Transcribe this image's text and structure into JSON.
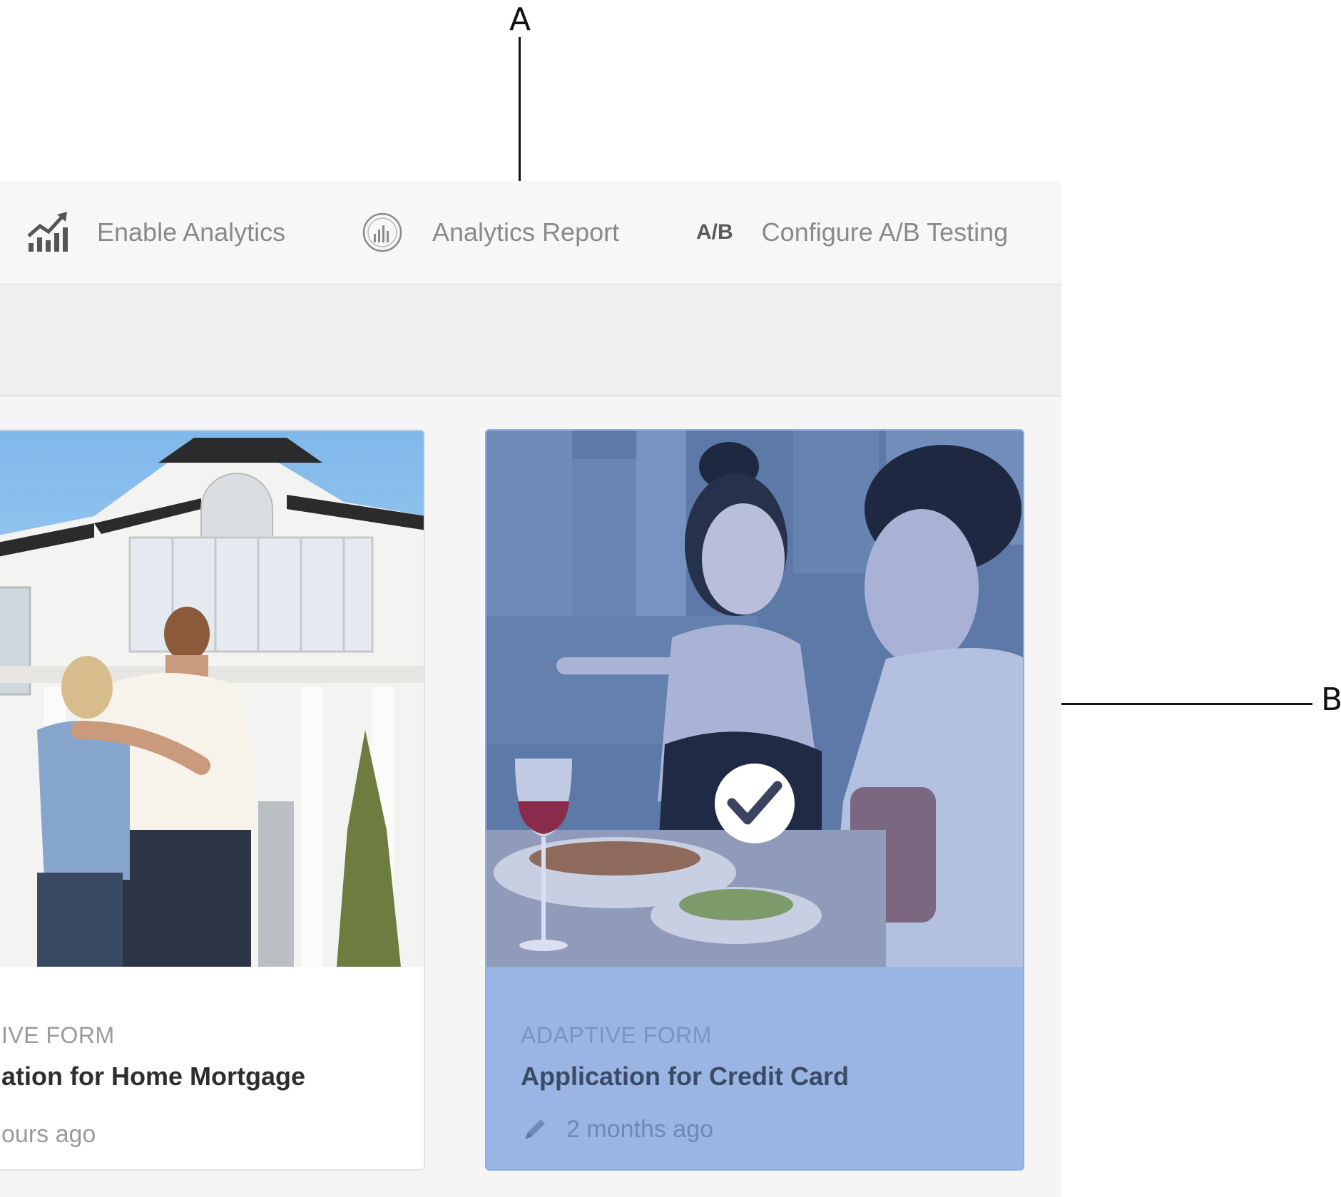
{
  "callouts": {
    "a": "A",
    "b": "B"
  },
  "toolbar": {
    "enable_analytics": {
      "label": "Enable Analytics",
      "icon": "chart-trend-icon"
    },
    "analytics_report": {
      "label": "Analytics Report",
      "icon": "analytics-report-icon"
    },
    "ab_testing": {
      "label": "Configure A/B Testing",
      "icon_text": "A/B"
    }
  },
  "cards": [
    {
      "type": "IVE FORM",
      "title": "ation for Home Mortgage",
      "time": "ours ago",
      "image": "couple-in-front-of-house"
    },
    {
      "type": "ADAPTIVE FORM",
      "title": "Application for Credit Card",
      "time": "2 months ago",
      "image": "couple-dining",
      "selected": true
    }
  ],
  "colors": {
    "selection_overlay": "#99b5e3",
    "toolbar_text": "#8a8a8a",
    "background": "#f5f5f5"
  }
}
